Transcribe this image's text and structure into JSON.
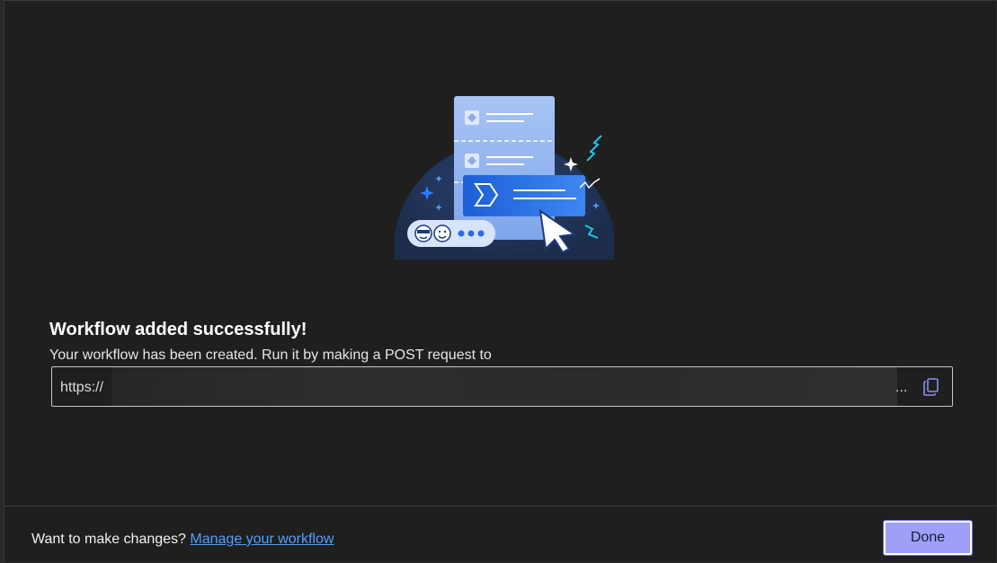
{
  "dialog": {
    "title": "Workflow added successfully!",
    "subtitle": "Your workflow has been created. Run it by making a POST request to",
    "url": {
      "prefix": "https://",
      "ellipsis": "...",
      "copy_icon": "copy-icon"
    },
    "footer": {
      "prompt": "Want to make changes?",
      "manage_link": "Manage your workflow",
      "done_label": "Done"
    },
    "illustration_icons": [
      "diamond-icon",
      "power-automate-icon",
      "cursor-icon",
      "sparkle-icon",
      "smiley-icon"
    ],
    "colors": {
      "accent": "#9f9ff8",
      "link": "#4ea1ff",
      "background": "#1f1f1f"
    }
  }
}
